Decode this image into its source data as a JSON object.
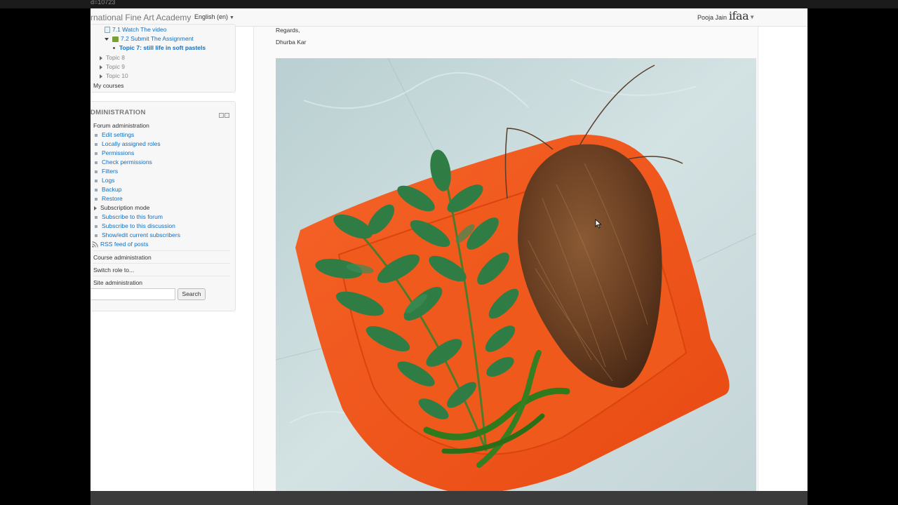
{
  "browser": {
    "url_fragment": "d=10723"
  },
  "navbar": {
    "brand": "rnational Fine Art Academy",
    "language": "English (en)",
    "user_name": "Pooja Jain",
    "logo_text": "ifaa"
  },
  "navigation": {
    "items": [
      {
        "label": "7.1 Watch The video"
      },
      {
        "label": "7.2 Submit The Assignment"
      },
      {
        "label": "Topic 7: still life in soft pastels"
      },
      {
        "label": "Topic 8"
      },
      {
        "label": "Topic 9"
      },
      {
        "label": "Topic 10"
      },
      {
        "label": "My courses"
      }
    ]
  },
  "administration": {
    "title": "DMINISTRATION",
    "forum_admin": "Forum administration",
    "links": [
      {
        "label": "Edit settings"
      },
      {
        "label": "Locally assigned roles"
      },
      {
        "label": "Permissions"
      },
      {
        "label": "Check permissions"
      },
      {
        "label": "Filters"
      },
      {
        "label": "Logs"
      },
      {
        "label": "Backup"
      },
      {
        "label": "Restore"
      }
    ],
    "subscription_mode": "Subscription mode",
    "subscribe_links": [
      {
        "label": "Subscribe to this forum"
      },
      {
        "label": "Subscribe to this discussion"
      },
      {
        "label": "Show/edit current subscribers"
      }
    ],
    "rss": "RSS feed of posts",
    "course_admin": "Course administration",
    "switch_role": "Switch role to...",
    "site_admin": "Site administration",
    "search_button": "Search"
  },
  "post": {
    "regards": "Regards,",
    "signer": "Dhurba Kar"
  },
  "colors": {
    "link": "#0f6fc5",
    "plate": "#f0531b",
    "floor": "#c9d9db"
  }
}
